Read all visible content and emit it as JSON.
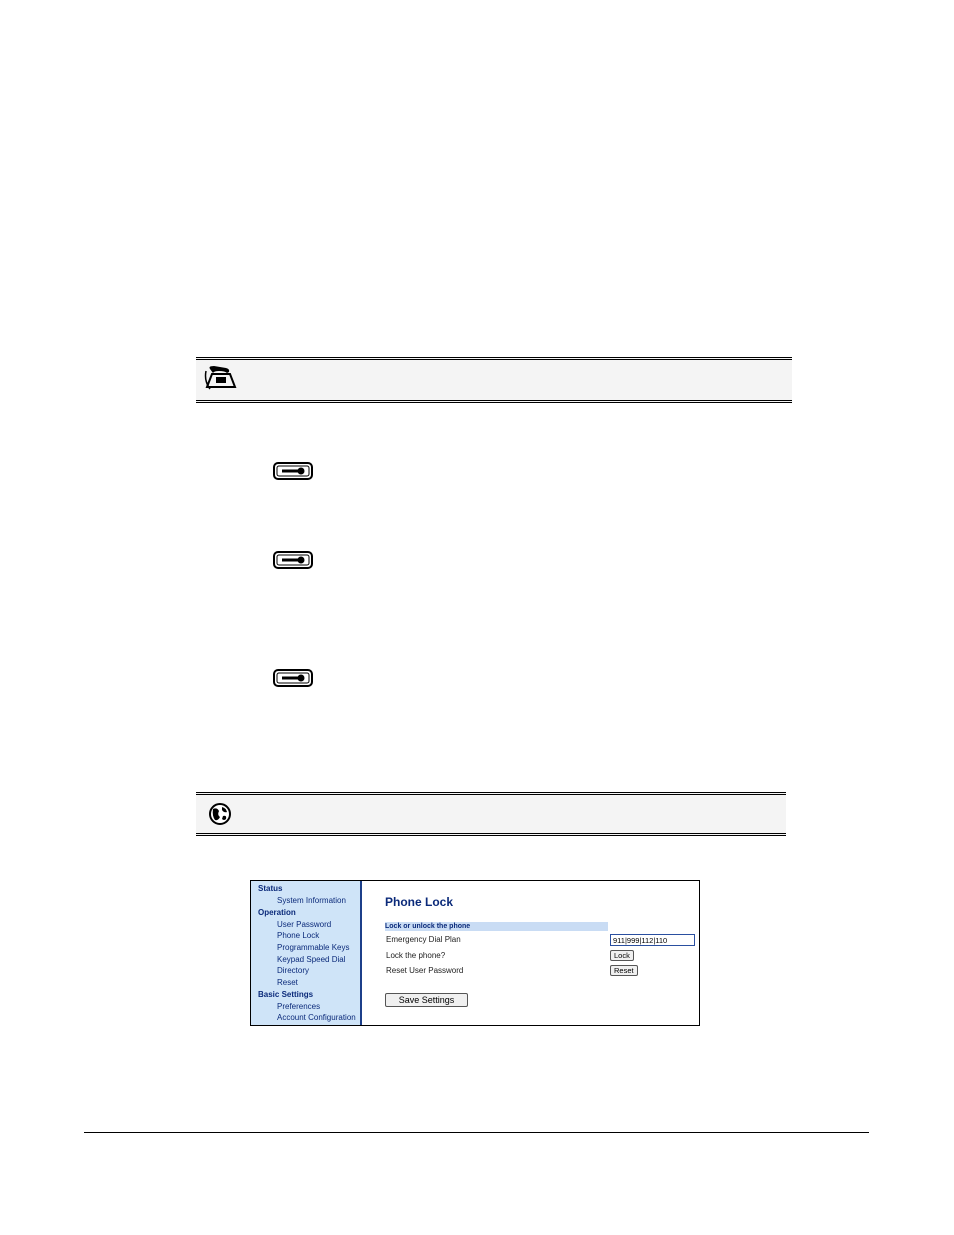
{
  "icons": {
    "phone_ui": "telephone-icon",
    "web_ui": "globe-icon",
    "options_key": "options-key-icon"
  },
  "webui": {
    "nav": {
      "status_label": "Status",
      "status_items": [
        "System Information"
      ],
      "operation_label": "Operation",
      "operation_items": [
        "User Password",
        "Phone Lock",
        "Programmable Keys",
        "Keypad Speed Dial",
        "Directory",
        "Reset"
      ],
      "basic_label": "Basic Settings",
      "basic_items": [
        "Preferences",
        "Account Configuration"
      ]
    },
    "page_title": "Phone Lock",
    "section_title": "Lock or unlock the phone",
    "emergency_label": "Emergency Dial Plan",
    "emergency_value": "911|999|112|110",
    "lock_label": "Lock the phone?",
    "lock_button": "Lock",
    "reset_label": "Reset User Password",
    "reset_button": "Reset",
    "save_button": "Save Settings"
  }
}
